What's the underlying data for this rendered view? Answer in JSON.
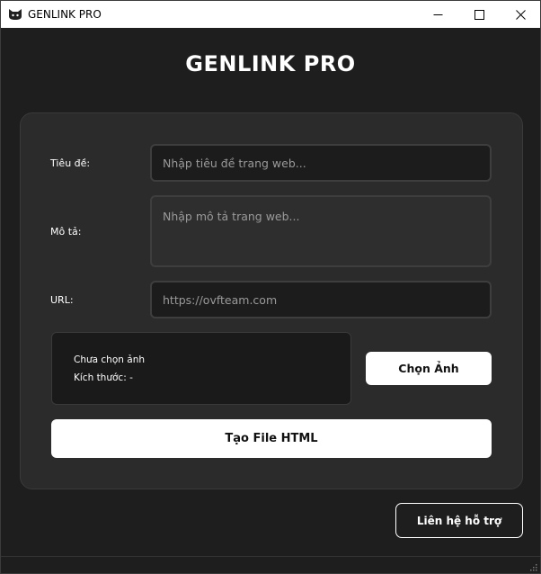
{
  "window": {
    "title": "GENLINK PRO",
    "icon": "cat-icon"
  },
  "app": {
    "heading": "GENLINK PRO"
  },
  "form": {
    "title_label": "Tiêu đề:",
    "title_placeholder": "Nhập tiêu đề trang web...",
    "title_value": "",
    "description_label": "Mô tả:",
    "description_placeholder": "Nhập mô tả trang web...",
    "description_value": "",
    "url_label": "URL:",
    "url_placeholder": "https://ovfteam.com",
    "url_value": ""
  },
  "image": {
    "status": "Chưa chọn ảnh",
    "size_label": "Kích thước: -",
    "choose_button": "Chọn Ảnh"
  },
  "actions": {
    "create_button": "Tạo File HTML",
    "support_button": "Liên hệ hỗ trợ"
  },
  "colors": {
    "background": "#1e1e1e",
    "card": "#2b2b2b",
    "input": "#1c1c1c",
    "button": "#ffffff"
  }
}
